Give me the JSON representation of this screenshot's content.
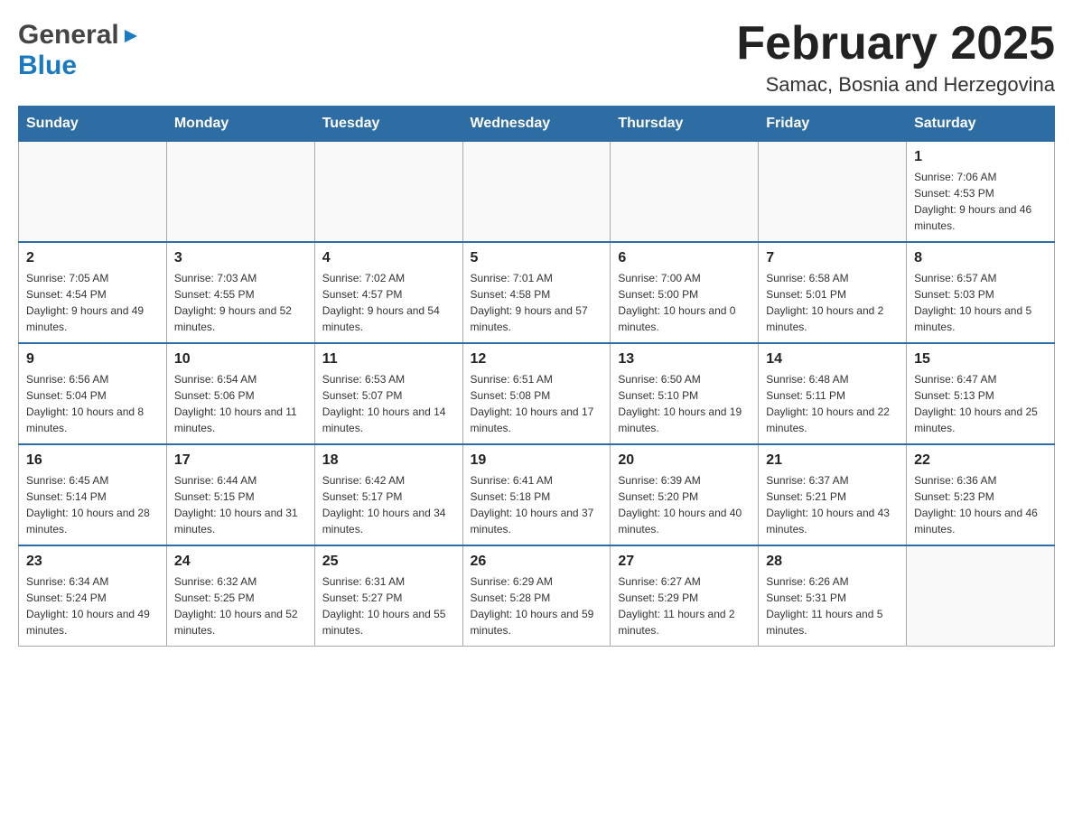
{
  "logo": {
    "general": "General",
    "blue": "Blue",
    "arrow": "▶"
  },
  "title": {
    "month_year": "February 2025",
    "location": "Samac, Bosnia and Herzegovina"
  },
  "days_of_week": [
    "Sunday",
    "Monday",
    "Tuesday",
    "Wednesday",
    "Thursday",
    "Friday",
    "Saturday"
  ],
  "weeks": [
    {
      "days": [
        {
          "number": "",
          "info": ""
        },
        {
          "number": "",
          "info": ""
        },
        {
          "number": "",
          "info": ""
        },
        {
          "number": "",
          "info": ""
        },
        {
          "number": "",
          "info": ""
        },
        {
          "number": "",
          "info": ""
        },
        {
          "number": "1",
          "info": "Sunrise: 7:06 AM\nSunset: 4:53 PM\nDaylight: 9 hours and 46 minutes."
        }
      ]
    },
    {
      "days": [
        {
          "number": "2",
          "info": "Sunrise: 7:05 AM\nSunset: 4:54 PM\nDaylight: 9 hours and 49 minutes."
        },
        {
          "number": "3",
          "info": "Sunrise: 7:03 AM\nSunset: 4:55 PM\nDaylight: 9 hours and 52 minutes."
        },
        {
          "number": "4",
          "info": "Sunrise: 7:02 AM\nSunset: 4:57 PM\nDaylight: 9 hours and 54 minutes."
        },
        {
          "number": "5",
          "info": "Sunrise: 7:01 AM\nSunset: 4:58 PM\nDaylight: 9 hours and 57 minutes."
        },
        {
          "number": "6",
          "info": "Sunrise: 7:00 AM\nSunset: 5:00 PM\nDaylight: 10 hours and 0 minutes."
        },
        {
          "number": "7",
          "info": "Sunrise: 6:58 AM\nSunset: 5:01 PM\nDaylight: 10 hours and 2 minutes."
        },
        {
          "number": "8",
          "info": "Sunrise: 6:57 AM\nSunset: 5:03 PM\nDaylight: 10 hours and 5 minutes."
        }
      ]
    },
    {
      "days": [
        {
          "number": "9",
          "info": "Sunrise: 6:56 AM\nSunset: 5:04 PM\nDaylight: 10 hours and 8 minutes."
        },
        {
          "number": "10",
          "info": "Sunrise: 6:54 AM\nSunset: 5:06 PM\nDaylight: 10 hours and 11 minutes."
        },
        {
          "number": "11",
          "info": "Sunrise: 6:53 AM\nSunset: 5:07 PM\nDaylight: 10 hours and 14 minutes."
        },
        {
          "number": "12",
          "info": "Sunrise: 6:51 AM\nSunset: 5:08 PM\nDaylight: 10 hours and 17 minutes."
        },
        {
          "number": "13",
          "info": "Sunrise: 6:50 AM\nSunset: 5:10 PM\nDaylight: 10 hours and 19 minutes."
        },
        {
          "number": "14",
          "info": "Sunrise: 6:48 AM\nSunset: 5:11 PM\nDaylight: 10 hours and 22 minutes."
        },
        {
          "number": "15",
          "info": "Sunrise: 6:47 AM\nSunset: 5:13 PM\nDaylight: 10 hours and 25 minutes."
        }
      ]
    },
    {
      "days": [
        {
          "number": "16",
          "info": "Sunrise: 6:45 AM\nSunset: 5:14 PM\nDaylight: 10 hours and 28 minutes."
        },
        {
          "number": "17",
          "info": "Sunrise: 6:44 AM\nSunset: 5:15 PM\nDaylight: 10 hours and 31 minutes."
        },
        {
          "number": "18",
          "info": "Sunrise: 6:42 AM\nSunset: 5:17 PM\nDaylight: 10 hours and 34 minutes."
        },
        {
          "number": "19",
          "info": "Sunrise: 6:41 AM\nSunset: 5:18 PM\nDaylight: 10 hours and 37 minutes."
        },
        {
          "number": "20",
          "info": "Sunrise: 6:39 AM\nSunset: 5:20 PM\nDaylight: 10 hours and 40 minutes."
        },
        {
          "number": "21",
          "info": "Sunrise: 6:37 AM\nSunset: 5:21 PM\nDaylight: 10 hours and 43 minutes."
        },
        {
          "number": "22",
          "info": "Sunrise: 6:36 AM\nSunset: 5:23 PM\nDaylight: 10 hours and 46 minutes."
        }
      ]
    },
    {
      "days": [
        {
          "number": "23",
          "info": "Sunrise: 6:34 AM\nSunset: 5:24 PM\nDaylight: 10 hours and 49 minutes."
        },
        {
          "number": "24",
          "info": "Sunrise: 6:32 AM\nSunset: 5:25 PM\nDaylight: 10 hours and 52 minutes."
        },
        {
          "number": "25",
          "info": "Sunrise: 6:31 AM\nSunset: 5:27 PM\nDaylight: 10 hours and 55 minutes."
        },
        {
          "number": "26",
          "info": "Sunrise: 6:29 AM\nSunset: 5:28 PM\nDaylight: 10 hours and 59 minutes."
        },
        {
          "number": "27",
          "info": "Sunrise: 6:27 AM\nSunset: 5:29 PM\nDaylight: 11 hours and 2 minutes."
        },
        {
          "number": "28",
          "info": "Sunrise: 6:26 AM\nSunset: 5:31 PM\nDaylight: 11 hours and 5 minutes."
        },
        {
          "number": "",
          "info": ""
        }
      ]
    }
  ]
}
